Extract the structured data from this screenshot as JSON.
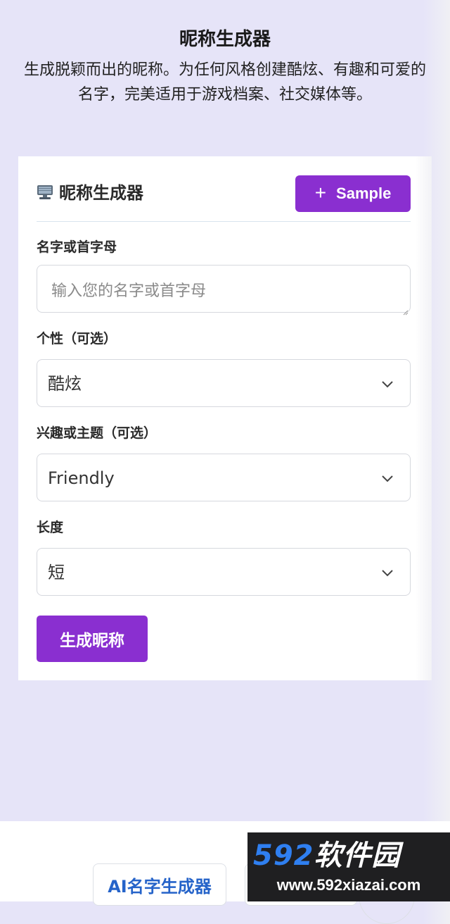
{
  "header": {
    "title": "昵称生成器",
    "subtitle": "生成脱颖而出的昵称。为任何风格创建酷炫、有趣和可爱的名字，完美适用于游戏档案、社交媒体等。"
  },
  "card": {
    "icon": "computer-icon",
    "title": "昵称生成器",
    "sample_button": {
      "icon": "plus-icon",
      "label": "Sample"
    },
    "name_field": {
      "label": "名字或首字母",
      "placeholder": "输入您的名字或首字母",
      "value": ""
    },
    "personality_field": {
      "label": "个性（可选）",
      "value": "酷炫"
    },
    "interest_field": {
      "label": "兴趣或主题（可选）",
      "value": "Friendly"
    },
    "length_field": {
      "label": "长度",
      "value": "短"
    },
    "generate_button": {
      "label": "生成昵称"
    }
  },
  "footer": {
    "links": [
      "AI名字生成器"
    ]
  },
  "watermark": {
    "main": "592软件园",
    "url": "www.592xiazai.com"
  },
  "colors": {
    "accent": "#8a2fd0",
    "background": "#e6e4f8",
    "link": "#2563c9"
  }
}
